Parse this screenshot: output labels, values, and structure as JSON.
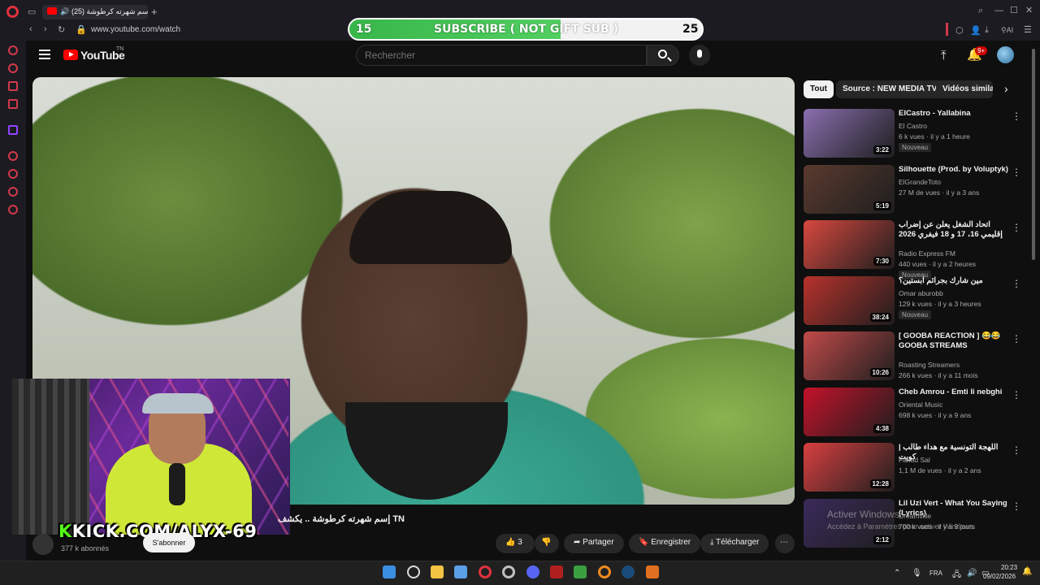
{
  "browser": {
    "tab_title": "(25) إسم شهرته كرطوشة",
    "url": "www.youtube.com/watch",
    "ai_label": "AI"
  },
  "stream_overlay": {
    "current": "15",
    "label": "SUBSCRIBE ( NOT GIFT SUB )",
    "goal": "25",
    "progress": 0.6,
    "kick_prefix": "K",
    "kick_url": "KICK.COM/ALYX-69"
  },
  "youtube": {
    "logo_text": "YouTube",
    "region": "TN",
    "search_placeholder": "Rechercher",
    "notif_count": "9+"
  },
  "video": {
    "title": "إسم شهرته كرطوشة .. يكشف",
    "title_suffix": "TN",
    "subscribers": "377 k abonnés",
    "subscribe_label": "S'abonner",
    "like_count": "3",
    "share": "Partager",
    "save": "Enregistrer",
    "download": "Télécharger"
  },
  "chips": [
    "Tout",
    "Source : NEW MEDIA TV",
    "Vidéos similaires"
  ],
  "recommendations": [
    {
      "title": "ElCastro - Yallabina",
      "channel": "El Castro",
      "meta": "6 k vues · il y a 1 heure",
      "duration": "3:22",
      "badge": "Nouveau",
      "color": "#8a6fb0"
    },
    {
      "title": "Silhouette (Prod. by Voluptyk)",
      "channel": "ElGrandeToto",
      "meta": "27 M de vues · il y a 3 ans",
      "duration": "5:19",
      "badge": "",
      "color": "#5a3a2e"
    },
    {
      "title": "اتحاد الشغل يعلن عن إضراب إقليمي 16، 17 و 18 فيفري 2026",
      "channel": "Radio Express FM",
      "meta": "440 vues · il y a 2 heures",
      "duration": "7:30",
      "badge": "Nouveau",
      "color": "#d8483f"
    },
    {
      "title": "مين شارك بجرائم ابستين؟",
      "channel": "Omar aburobb",
      "meta": "129 k vues · il y a 3 heures",
      "duration": "38:24",
      "badge": "Nouveau",
      "color": "#b8322b"
    },
    {
      "title": "[ GOOBA REACTION ] 😂😂 GOOBA STREAMS HIGHLIGHT...",
      "channel": "Roasting Streamers",
      "meta": "266 k vues · il y a 11 mois",
      "duration": "10:26",
      "badge": "",
      "color": "#c24a4a"
    },
    {
      "title": "Cheb Amrou - Emti li nebghi",
      "channel": "Oriental Music",
      "meta": "698 k vues · il y a 9 ans",
      "duration": "4:38",
      "badge": "",
      "color": "#c4122a"
    },
    {
      "title": "اللهجة التونسية مع هداء طالب | كويت",
      "channel": "Fahad Sal",
      "meta": "1,1 M de vues · il y a 2 ans",
      "duration": "12:28",
      "badge": "",
      "color": "#d94040"
    },
    {
      "title": "Lil Uzi Vert - What You Saying (Lyrics)",
      "channel": "Dreamville",
      "meta": "700 k vues · il y a 9 jours",
      "duration": "2:12",
      "badge": "",
      "color": "#3a2a5a"
    }
  ],
  "watermark": {
    "line1": "Activer Windows",
    "line2": "Accédez à Paramètres pour activer Windows."
  },
  "taskbar": {
    "lang": "FRA",
    "time": "20:23",
    "date": "09/02/2026"
  }
}
